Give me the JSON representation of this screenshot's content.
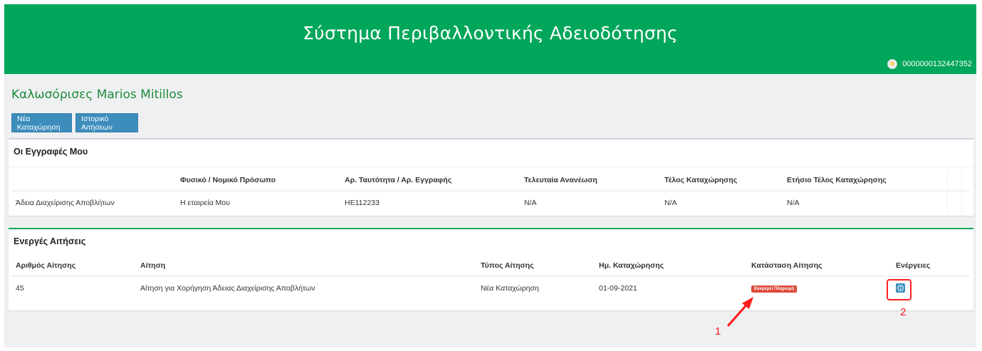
{
  "header": {
    "title": "Σύστημα Περιβαλλοντικής Αδειοδότησης",
    "user_id": "0000000132447352",
    "color": "#00a65a"
  },
  "welcome": "Καλωσόρισες Marios Mitillos",
  "toolbar": {
    "new_entry": "Νέα Καταχώρηση",
    "history": "Ιστορικό Αιτήσεων"
  },
  "registrations": {
    "title": "Οι Εγγραφές Μου",
    "columns": [
      "",
      "Φυσικό / Νομικό Πρόσωπο",
      "Αρ. Ταυτότητα / Αρ. Εγγραφής",
      "Τελευταία Ανανέωση",
      "Τέλος Καταχώρησης",
      "Ετήσιο Τέλος Καταχώρησης"
    ],
    "rows": [
      [
        "Άδεια Διαχείρισης Αποβλήτων",
        "Η εταιρεία Μου",
        "HE112233",
        "N/A",
        "N/A",
        "N/A"
      ]
    ]
  },
  "active": {
    "title": "Ενεργές Αιτήσεις",
    "columns": [
      "Αριθμός Αίτησης",
      "Αίτηση",
      "Τύπος Αίτησης",
      "Ημ. Καταχώρησης",
      "Κατάσταση Αίτησης",
      "Ενέργειες"
    ],
    "rows": [
      {
        "number": "45",
        "application": "Αίτηση για Χορήγηση Άδειας Διαχείρισης Αποβλήτων",
        "type": "Νέα Καταχώρηση",
        "date": "01-09-2021",
        "status": "Εκκρεμεί Πληρωμή",
        "status_color": "#dd4b39"
      }
    ]
  },
  "annotations": {
    "label_1": "1",
    "label_2": "2",
    "color": "#ff1a1a"
  }
}
